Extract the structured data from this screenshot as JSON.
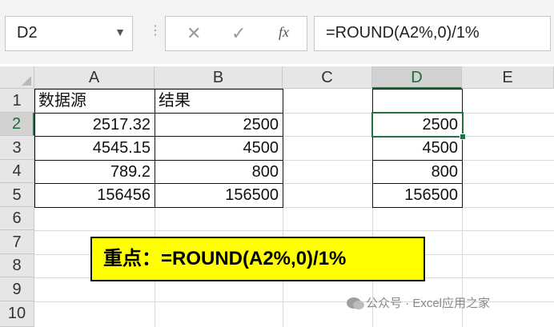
{
  "formula_bar": {
    "name_box": "D2",
    "cancel_glyph": "✕",
    "enter_glyph": "✓",
    "fx_label": "fx",
    "formula": "=ROUND(A2%,0)/1%"
  },
  "columns": [
    "A",
    "B",
    "C",
    "D",
    "E"
  ],
  "rows": [
    "1",
    "2",
    "3",
    "4",
    "5",
    "6",
    "7",
    "8",
    "9",
    "10"
  ],
  "table": {
    "header_a": "数据源",
    "header_b": "结果",
    "col_a": [
      "2517.32",
      "4545.15",
      "789.2",
      "156456"
    ],
    "col_b": [
      "2500",
      "4500",
      "800",
      "156500"
    ],
    "col_d": [
      "2500",
      "4500",
      "800",
      "156500"
    ]
  },
  "callout": "重点：=ROUND(A2%,0)/1%",
  "watermark": "公众号 · Excel应用之家",
  "icons": {
    "name_box_dropdown": "chevron-down-icon",
    "cancel": "close-icon",
    "enter": "check-icon",
    "function": "fx-icon",
    "watermark": "wechat-icon"
  },
  "colors": {
    "selection": "#217346",
    "callout_bg": "#ffff00"
  }
}
